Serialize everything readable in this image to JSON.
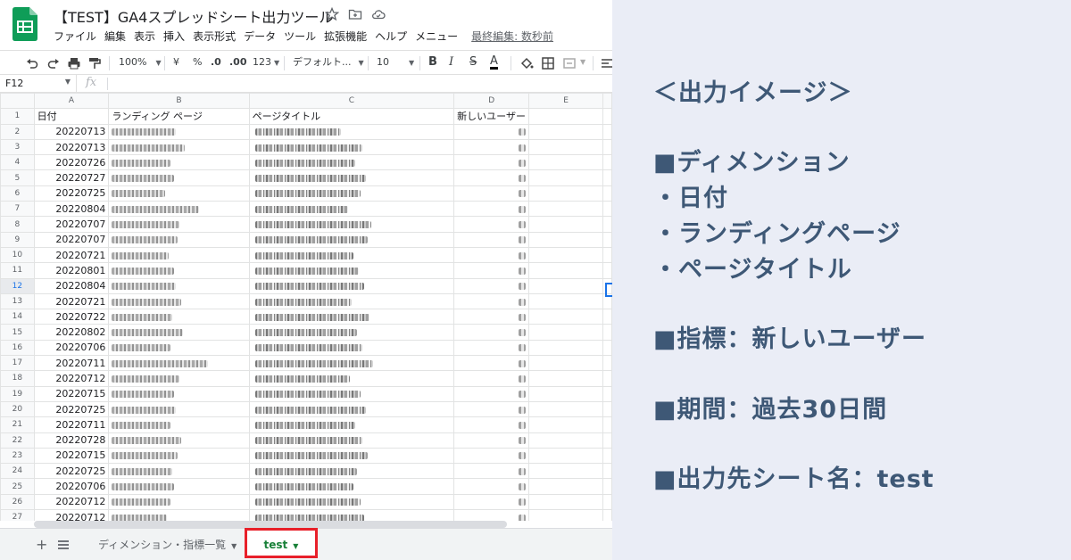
{
  "app": {
    "title": "【TEST】GA4スプレッドシート出力ツール",
    "menu": [
      "ファイル",
      "編集",
      "表示",
      "挿入",
      "表示形式",
      "データ",
      "ツール",
      "拡張機能",
      "ヘルプ",
      "メニュー"
    ],
    "last_edit": "最終編集: 数秒前"
  },
  "toolbar": {
    "zoom": "100%",
    "currency": "¥",
    "percent": "%",
    "decimal_decrease": ".0",
    "decimal_increase": ".00",
    "more_formats": "123",
    "font": "デフォルト...",
    "font_size": "10",
    "bold": "B",
    "italic": "I",
    "strike": "S",
    "text_color": "A"
  },
  "formula_bar": {
    "cell_ref": "F12",
    "fx": "fx"
  },
  "grid": {
    "columns": [
      "A",
      "B",
      "C",
      "D",
      "E"
    ],
    "header_row": [
      "日付",
      "ランディング ページ",
      "ページタイトル",
      "新しいユーザー",
      ""
    ],
    "dates": [
      "20220713",
      "20220713",
      "20220726",
      "20220727",
      "20220725",
      "20220804",
      "20220707",
      "20220707",
      "20220721",
      "20220801",
      "20220804",
      "20220721",
      "20220722",
      "20220802",
      "20220706",
      "20220711",
      "20220712",
      "20220715",
      "20220725",
      "20220711",
      "20220728",
      "20220715",
      "20220725",
      "20220706",
      "20220712",
      "20220712"
    ],
    "row_numbers": [
      "1",
      "2",
      "3",
      "4",
      "5",
      "6",
      "7",
      "8",
      "9",
      "10",
      "11",
      "12",
      "13",
      "14",
      "15",
      "16",
      "17",
      "18",
      "19",
      "20",
      "21",
      "22",
      "23",
      "24",
      "25",
      "26",
      "27"
    ],
    "selected_row": "12"
  },
  "tabs": {
    "add": "+",
    "sheet1": "ディメンション・指標一覧",
    "sheet2": "test"
  },
  "info": {
    "heading": "＜出力イメージ＞",
    "dimension_title": "■ディメンション",
    "dimension_items": [
      "・日付",
      "・ランディングページ",
      "・ページタイトル"
    ],
    "metric": "■指標：新しいユーザー",
    "period": "■期間：過去30日間",
    "output_sheet": "■出力先シート名：test"
  },
  "colors": {
    "panel_bg": "#eaedf6",
    "panel_text": "#3e5876",
    "sheets_green": "#0f9d58",
    "highlight_red": "#e8202a",
    "active_tab_text": "#188038"
  }
}
